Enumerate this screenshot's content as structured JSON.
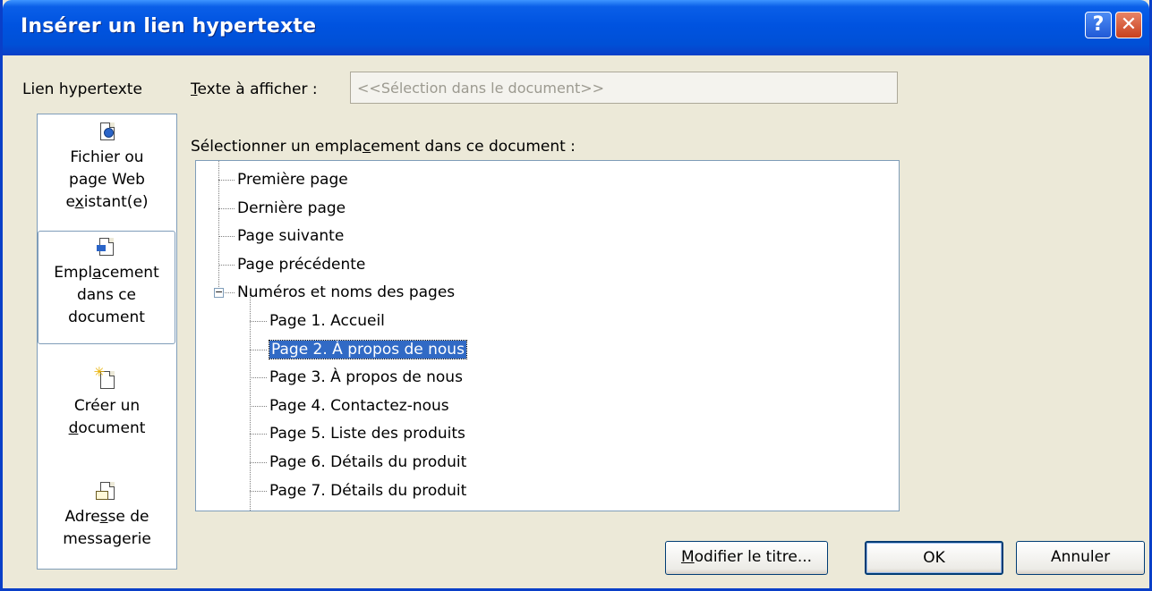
{
  "window": {
    "title": "Insérer un lien hypertexte"
  },
  "sidebar": {
    "label": "Lien hypertexte",
    "places": [
      {
        "line1": "Fichier ou",
        "line2": "page Web",
        "line3": "existant(e)",
        "icon": "existing-file-icon",
        "selected": false
      },
      {
        "line1": "Emplacement",
        "line2": "dans ce",
        "line3": "document",
        "icon": "place-in-document-icon",
        "selected": true
      },
      {
        "line1": "Créer un",
        "line2": "document",
        "icon": "new-document-icon",
        "selected": false
      },
      {
        "line1": "Adresse de",
        "line2": "messagerie",
        "icon": "email-address-icon",
        "selected": false
      }
    ]
  },
  "text_to_display": {
    "label": "Texte à afficher :",
    "value": "<<Sélection dans le document>>"
  },
  "location": {
    "label": "Sélectionner un emplacement dans ce document :",
    "items": [
      {
        "text": "Première page",
        "level": 0
      },
      {
        "text": "Dernière page",
        "level": 0
      },
      {
        "text": "Page suivante",
        "level": 0
      },
      {
        "text": "Page précédente",
        "level": 0
      },
      {
        "text": "Numéros et noms des pages",
        "level": 0,
        "expanded": true
      },
      {
        "text": "Page 1. Accueil",
        "level": 1
      },
      {
        "text": "Page 2. À propos de nous",
        "level": 1,
        "selected": true
      },
      {
        "text": "Page 3. À propos de nous",
        "level": 1
      },
      {
        "text": "Page 4. Contactez-nous",
        "level": 1
      },
      {
        "text": "Page 5. Liste des produits",
        "level": 1
      },
      {
        "text": "Page 6. Détails du produit",
        "level": 1
      },
      {
        "text": "Page 7. Détails du produit",
        "level": 1
      }
    ]
  },
  "buttons": {
    "edit_title": "Modifier le titre...",
    "ok": "OK",
    "cancel": "Annuler"
  },
  "colors": {
    "titlebar": "#0053e0",
    "selection": "#316ac5",
    "dialog_bg": "#ece9d8"
  }
}
